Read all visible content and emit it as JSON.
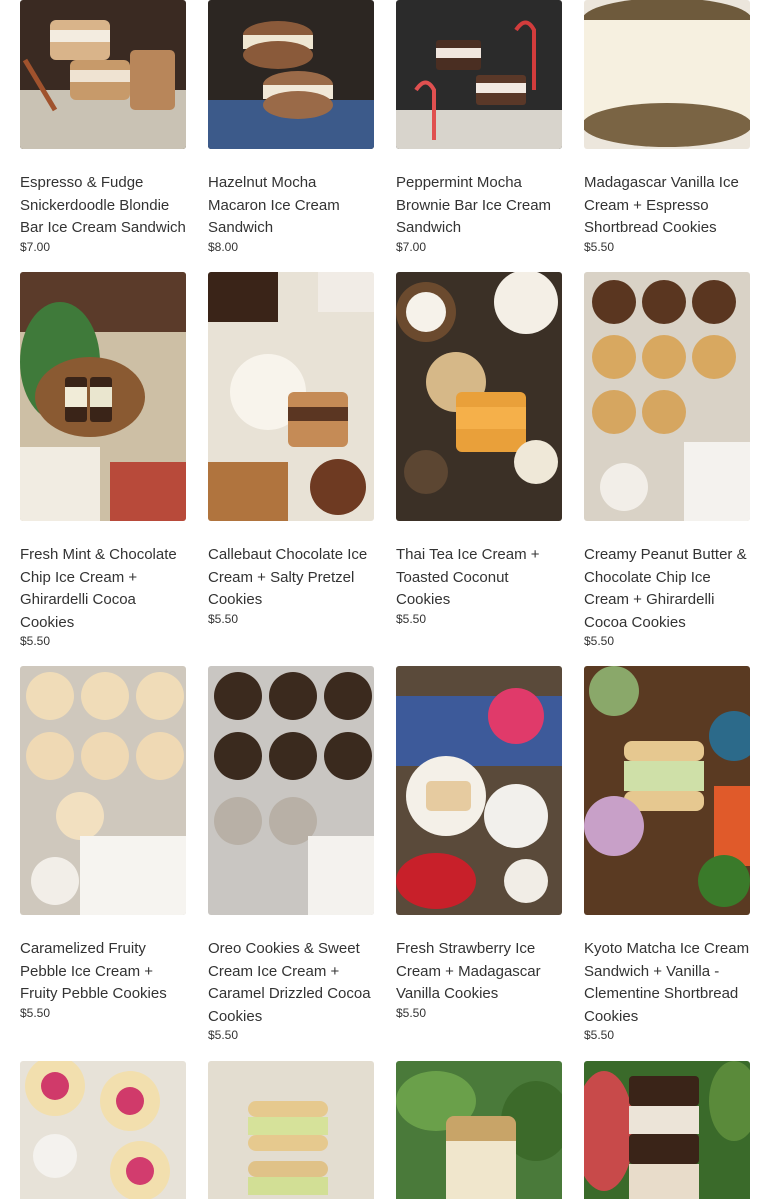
{
  "products": [
    {
      "title": "Espresso & Fudge Snickerdoodle Blondie Bar Ice Cream Sandwich",
      "price": "$7.00",
      "image": "espresso-fudge-blondie-photo"
    },
    {
      "title": "Hazelnut Mocha Macaron Ice Cream Sandwich",
      "price": "$8.00",
      "image": "hazelnut-mocha-macaron-photo"
    },
    {
      "title": "Peppermint Mocha Brownie Bar Ice Cream Sandwich",
      "price": "$7.00",
      "image": "peppermint-mocha-brownie-photo"
    },
    {
      "title": "Madagascar Vanilla Ice Cream + Espresso Shortbread Cookies",
      "price": "$5.50",
      "image": "madagascar-vanilla-espresso-photo"
    },
    {
      "title": "Fresh Mint & Chocolate Chip Ice Cream + Ghirardelli Cocoa Cookies",
      "price": "$5.50",
      "image": "fresh-mint-chocolate-chip-photo"
    },
    {
      "title": "Callebaut Chocolate Ice Cream + Salty Pretzel Cookies",
      "price": "$5.50",
      "image": "callebaut-chocolate-pretzel-photo"
    },
    {
      "title": "Thai Tea Ice Cream + Toasted Coconut Cookies",
      "price": "$5.50",
      "image": "thai-tea-coconut-photo"
    },
    {
      "title": "Creamy Peanut Butter & Chocolate Chip Ice Cream + Ghirardelli Cocoa Cookies",
      "price": "$5.50",
      "image": "peanut-butter-chocolate-chip-photo"
    },
    {
      "title": "Caramelized Fruity Pebble Ice Cream + Fruity Pebble Cookies",
      "price": "$5.50",
      "image": "fruity-pebble-photo"
    },
    {
      "title": "Oreo Cookies & Sweet Cream Ice Cream + Caramel Drizzled Cocoa Cookies",
      "price": "$5.50",
      "image": "oreo-sweet-cream-photo"
    },
    {
      "title": "Fresh Strawberry Ice Cream + Madagascar Vanilla Cookies",
      "price": "$5.50",
      "image": "fresh-strawberry-photo"
    },
    {
      "title": "Kyoto Matcha Ice Cream Sandwich + Vanilla - Clementine Shortbread Cookies",
      "price": "$5.50",
      "image": "kyoto-matcha-photo"
    },
    {
      "title": "",
      "price": "",
      "image": "raspberry-cookies-photo"
    },
    {
      "title": "",
      "price": "",
      "image": "pistachio-sandwich-photo"
    },
    {
      "title": "",
      "price": "",
      "image": "crumble-bar-photo"
    },
    {
      "title": "",
      "price": "",
      "image": "chocolate-layer-bar-photo"
    }
  ]
}
